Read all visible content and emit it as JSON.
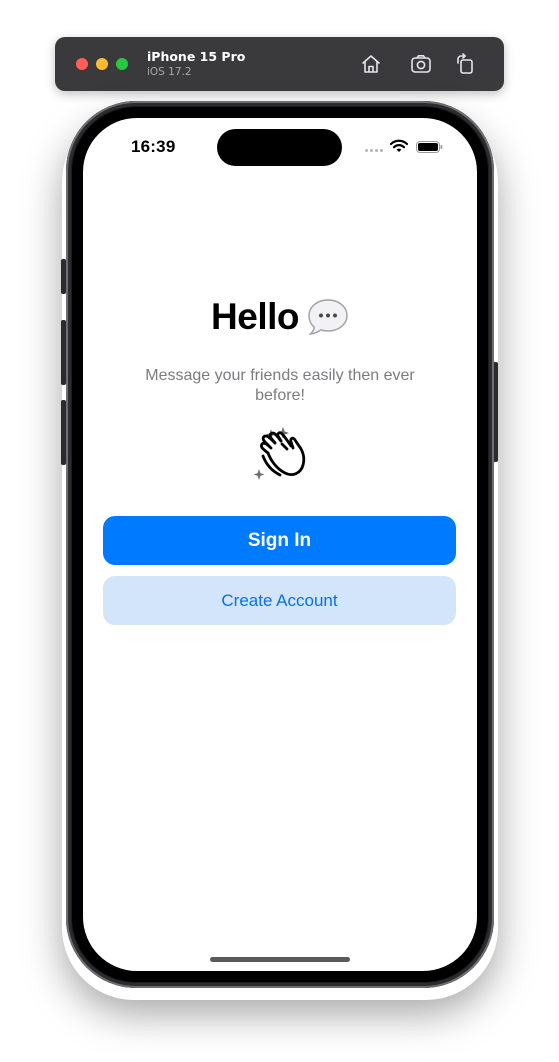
{
  "simulator": {
    "device_name": "iPhone 15 Pro",
    "os_version": "iOS 17.2",
    "icons": [
      "home-icon",
      "screenshot-icon",
      "rotate-icon"
    ]
  },
  "status_bar": {
    "time": "16:39",
    "icons": [
      "cellular-signal-icon",
      "wifi-icon",
      "battery-icon"
    ]
  },
  "welcome": {
    "title": "Hello",
    "title_emoji": "speech-bubble-icon",
    "subtitle": "Message your friends easily then ever before!",
    "illustration": "clapping-hands-icon"
  },
  "actions": {
    "sign_in_label": "Sign In",
    "create_account_label": "Create Account"
  },
  "colors": {
    "primary": "#007aff",
    "secondary_bg": "#d3e5fb",
    "secondary_text": "#0a70e6",
    "subtitle_text": "#7c7c80"
  }
}
